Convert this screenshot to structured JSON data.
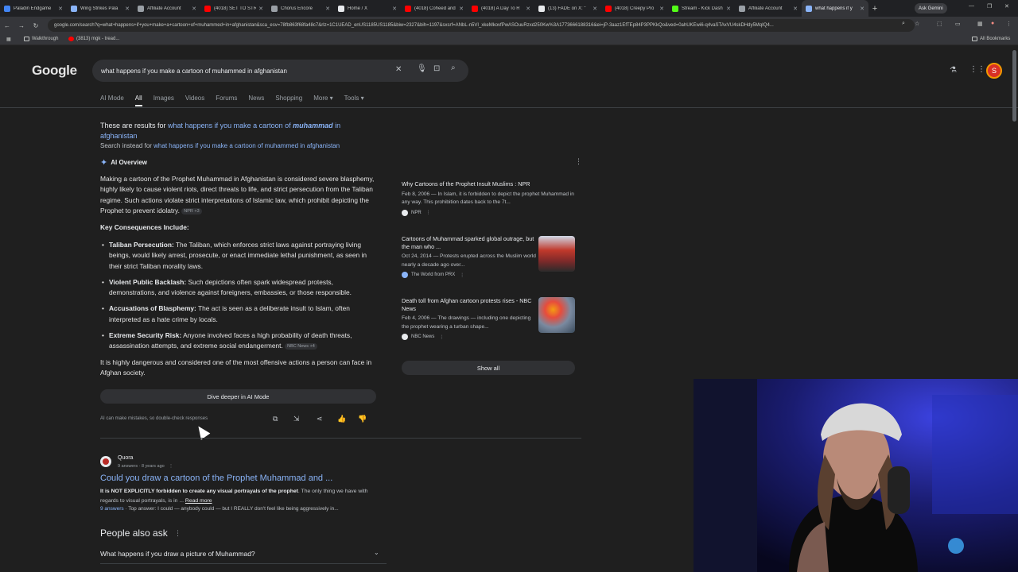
{
  "browser": {
    "tabs": [
      {
        "label": "Paladin Endgame",
        "color": "#4285f4"
      },
      {
        "label": "Wing Strikes Pala",
        "color": "#8ab4f8"
      },
      {
        "label": "Affiliate Account",
        "color": "#9aa0a6"
      },
      {
        "label": "(4018) SET TO STR",
        "color": "#ff0000"
      },
      {
        "label": "Chorus Encore",
        "color": "#9aa0a6"
      },
      {
        "label": "Home / X",
        "color": "#e8eaed"
      },
      {
        "label": "(4018) Coheed and",
        "color": "#ff0000"
      },
      {
        "label": "(4018) A Day To R",
        "color": "#ff0000"
      },
      {
        "label": "(13) FADE on X: \"",
        "color": "#e8eaed"
      },
      {
        "label": "(4018) Creepy Pro",
        "color": "#ff0000"
      },
      {
        "label": "Stream - Kick Dash",
        "color": "#53fc18"
      },
      {
        "label": "Affiliate Account",
        "color": "#9aa0a6"
      },
      {
        "label": "what happens if y",
        "color": "#8ab4f8"
      }
    ],
    "ask_gemini": "Ask Gemini",
    "url": "google.com/search?q=what+happens+if+you+make+a+cartoon+of+muhammed+in+afghanistan&sca_esv=78fb863f68fa48c7&rlz=1C1UEAD_enUS1185US1185&biw=2327&bih=1197&sxsrf=ANbL-n5VI_xkeMkovfPwASOuuRzxd250Kw%3A1773666188316&ei=jP-3aaz1EfTEp84P3PPKkQo&ved=0ahUKEwi6-q4vaSTAxVU4skDHdy5MqIQ4...",
    "bookmarks": [
      {
        "label": "Walkthrough"
      },
      {
        "label": "(3813) mgk - tread..."
      }
    ],
    "all_bookmarks": "All Bookmarks"
  },
  "google": {
    "logo": "Google",
    "query": "what happens if you make a cartoon of muhammed in afghanistan",
    "tabs": [
      "AI Mode",
      "All",
      "Images",
      "Videos",
      "Forums",
      "News",
      "Shopping",
      "More ▾",
      "Tools ▾"
    ],
    "avatar_letter": "S",
    "correction": {
      "prefix": "These are results for ",
      "link_before": "what happens if you make a cartoon of ",
      "link_bold": "muhammad",
      "link_after": " in afghanistan",
      "instead_prefix": "Search instead for ",
      "instead_link": "what happens if you make a cartoon of muhammed in afghanistan"
    },
    "ai_overview": {
      "label": "AI Overview",
      "intro": "Making a cartoon of the Prophet Muhammad in Afghanistan is considered severe blasphemy, highly likely to cause violent riots, direct threats to life, and strict persecution from the Taliban regime. Such actions violate strict interpretations of Islamic law, which prohibit depicting the Prophet to prevent idolatry.",
      "intro_chip": "NPR +3",
      "heading": "Key Consequences Include:",
      "bullets": [
        {
          "title": "Taliban Persecution:",
          "text": " The Taliban, which enforces strict laws against portraying living beings, would likely arrest, prosecute, or enact immediate lethal punishment, as seen in their strict Taliban morality laws."
        },
        {
          "title": "Violent Public Backlash:",
          "text": " Such depictions often spark widespread protests, demonstrations, and violence against foreigners, embassies, or those responsible."
        },
        {
          "title": "Accusations of Blasphemy:",
          "text": " The act is seen as a deliberate insult to Islam, often interpreted as a hate crime by locals."
        },
        {
          "title": "Extreme Security Risk:",
          "text": " Anyone involved faces a high probability of death threats, assassination attempts, and extreme social endangerment.",
          "chip": "NBC News +4"
        }
      ],
      "conclusion": "It is highly dangerous and considered one of the most offensive actions a person can face in Afghan society.",
      "dive_deeper": "Dive deeper in AI Mode",
      "disclaimer": "AI can make mistakes, so double-check responses",
      "sources": [
        {
          "title": "Why Cartoons of the Prophet Insult Muslims : NPR",
          "snippet": "Feb 8, 2006 — In Islam, it is forbidden to depict the prophet Muhammad in any way. This prohibition dates back to the 7t...",
          "site": "NPR"
        },
        {
          "title": "Cartoons of Muhammad sparked global outrage, but the man who ...",
          "snippet": "Oct 24, 2014 — Protests erupted across the Muslim world nearly a decade ago over...",
          "site": "The World from PRX"
        },
        {
          "title": "Death toll from Afghan cartoon protests rises - NBC News",
          "snippet": "Feb 4, 2006 — The drawings — including one depicting the prophet wearing a turban shape...",
          "site": "NBC News"
        }
      ],
      "show_all": "Show all"
    },
    "result": {
      "site": "Quora",
      "meta": "9 answers · 8 years ago",
      "title": "Could you draw a cartoon of the Prophet Muhammad and ...",
      "snippet_bold": "It is NOT EXPLICITLY forbidden to create any visual portrayals of the prophet",
      "snippet_rest": ". The only thing we have with regards to visual portrayals, is in ...",
      "read_more": "Read more",
      "answers_link": "9 answers",
      "answers_text": " · Top answer: I could — anybody could — but I REALLY don't feel like being aggressively in..."
    },
    "people_also_ask": {
      "heading": "People also ask",
      "questions": [
        "What happens if you draw a picture of Muhammad?"
      ]
    }
  }
}
